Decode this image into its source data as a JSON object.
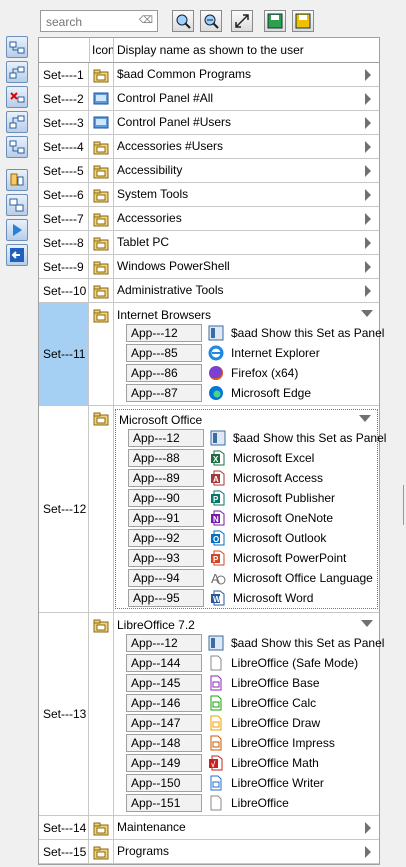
{
  "search": {
    "placeholder": "search"
  },
  "toolbar": {
    "icons": [
      "zoom-in-icon",
      "zoom-out-icon",
      "expand-icon",
      "save-icon",
      "save-as-icon"
    ]
  },
  "sidebar": {
    "icons": [
      "add-set-icon",
      "add-app-icon",
      "delete-icon",
      "move-up-icon",
      "move-down-icon",
      "copy-icon",
      "duplicate-icon",
      "run-icon",
      "back-icon"
    ]
  },
  "table": {
    "headers": [
      "",
      "Icon",
      "Display name as shown to the user"
    ],
    "rows": [
      {
        "id": "Set----1",
        "name": "$aad Common Programs",
        "icon": "folder-icon"
      },
      {
        "id": "Set----2",
        "name": "Control Panel #All",
        "icon": "control-panel-icon"
      },
      {
        "id": "Set----3",
        "name": "Control Panel #Users",
        "icon": "control-panel-icon"
      },
      {
        "id": "Set----4",
        "name": "Accessories #Users",
        "icon": "folder-icon"
      },
      {
        "id": "Set----5",
        "name": "Accessibility",
        "icon": "folder-icon"
      },
      {
        "id": "Set----6",
        "name": "System Tools",
        "icon": "folder-icon"
      },
      {
        "id": "Set----7",
        "name": "Accessories",
        "icon": "folder-icon"
      },
      {
        "id": "Set----8",
        "name": "Tablet PC",
        "icon": "folder-icon"
      },
      {
        "id": "Set----9",
        "name": "Windows PowerShell",
        "icon": "folder-icon"
      },
      {
        "id": "Set---10",
        "name": "Administrative Tools",
        "icon": "folder-icon"
      }
    ],
    "groups": [
      {
        "id": "Set---11",
        "name": "Internet Browsers",
        "apps": [
          {
            "id": "App---12",
            "name": "$aad Show this Set as Panel",
            "icon": "panel-icon",
            "color": "#3a6ea5"
          },
          {
            "id": "App---85",
            "name": "Internet Explorer",
            "icon": "ie-icon",
            "color": "#1e88e5"
          },
          {
            "id": "App---86",
            "name": "Firefox (x64)",
            "icon": "firefox-icon",
            "color": "#e66000"
          },
          {
            "id": "App---87",
            "name": "Microsoft Edge",
            "icon": "edge-icon",
            "color": "#0078d7"
          }
        ]
      },
      {
        "id": "Set---12",
        "name": "Microsoft Office",
        "apps": [
          {
            "id": "App---12",
            "name": "$aad Show this Set as Panel",
            "icon": "panel-icon",
            "color": "#3a6ea5"
          },
          {
            "id": "App---88",
            "name": "Microsoft Excel",
            "icon": "excel-icon",
            "color": "#1d6f42"
          },
          {
            "id": "App---89",
            "name": "Microsoft Access",
            "icon": "access-icon",
            "color": "#a4373a"
          },
          {
            "id": "App---90",
            "name": "Microsoft Publisher",
            "icon": "publisher-icon",
            "color": "#077568"
          },
          {
            "id": "App---91",
            "name": "Microsoft OneNote",
            "icon": "onenote-icon",
            "color": "#7719aa"
          },
          {
            "id": "App---92",
            "name": "Microsoft Outlook",
            "icon": "outlook-icon",
            "color": "#0072c6"
          },
          {
            "id": "App---93",
            "name": "Microsoft PowerPoint",
            "icon": "powerpoint-icon",
            "color": "#d24726"
          },
          {
            "id": "App---94",
            "name": "Microsoft Office Language",
            "icon": "language-icon",
            "color": "#6c6c6c"
          },
          {
            "id": "App---95",
            "name": "Microsoft Word",
            "icon": "word-icon",
            "color": "#2b579a"
          }
        ]
      },
      {
        "id": "Set---13",
        "name": "LibreOffice 7.2",
        "apps": [
          {
            "id": "App---12",
            "name": "$aad Show this Set as Panel",
            "icon": "panel-icon",
            "color": "#3a6ea5"
          },
          {
            "id": "App--144",
            "name": "LibreOffice (Safe Mode)",
            "icon": "document-icon",
            "color": "#888888"
          },
          {
            "id": "App--145",
            "name": "LibreOffice Base",
            "icon": "libre-base-icon",
            "color": "#8e2ab5"
          },
          {
            "id": "App--146",
            "name": "LibreOffice Calc",
            "icon": "libre-calc-icon",
            "color": "#18a303"
          },
          {
            "id": "App--147",
            "name": "LibreOffice Draw",
            "icon": "libre-draw-icon",
            "color": "#e8a202"
          },
          {
            "id": "App--148",
            "name": "LibreOffice Impress",
            "icon": "libre-impress-icon",
            "color": "#c45a00"
          },
          {
            "id": "App--149",
            "name": "LibreOffice Math",
            "icon": "libre-math-icon",
            "color": "#c9211e"
          },
          {
            "id": "App--150",
            "name": "LibreOffice Writer",
            "icon": "libre-writer-icon",
            "color": "#2a6ccf"
          },
          {
            "id": "App--151",
            "name": "LibreOffice",
            "icon": "document-icon",
            "color": "#888888"
          }
        ]
      }
    ],
    "tail_rows": [
      {
        "id": "Set---14",
        "name": "Maintenance",
        "icon": "folder-icon"
      },
      {
        "id": "Set---15",
        "name": "Programs",
        "icon": "folder-icon"
      }
    ]
  }
}
